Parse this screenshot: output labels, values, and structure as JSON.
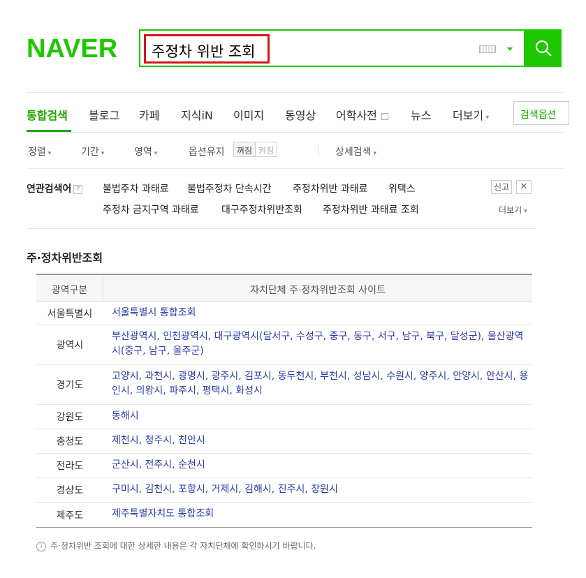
{
  "logo": "NAVER",
  "search": {
    "query": "주정차 위반 조회"
  },
  "tabs": [
    "통합검색",
    "블로그",
    "카페",
    "지식iN",
    "이미지",
    "동영상",
    "어학사전",
    "뉴스",
    "더보기"
  ],
  "search_options_label": "검색옵션",
  "filters": {
    "sort": "정렬",
    "period": "기간",
    "area": "영역",
    "keep": "옵션유지",
    "toggle_on": "꺼짐",
    "toggle_off": "켜짐",
    "detail": "상세검색"
  },
  "related": {
    "title": "연관검색어",
    "row1": [
      "불법주차 과태료",
      "불법주정차 단속시간",
      "주정차위반 과태료",
      "위택스"
    ],
    "row2": [
      "주정차 금지구역 과태료",
      "대구주정차위반조회",
      "주정차위반 과태료 조회"
    ],
    "report": "신고",
    "more": "더보기"
  },
  "section_title": "주·정차위반조회",
  "table": {
    "headers": [
      "광역구분",
      "자치단체 주·정차위반조회 사이트"
    ],
    "rows": [
      {
        "region": "서울특별시",
        "sites": "서울특별시 통합조회"
      },
      {
        "region": "광역시",
        "sites": "부산광역시, 인천광역시, 대구광역시(달서구, 수성구, 중구, 동구, 서구, 남구, 북구, 달성군), 울산광역시(중구, 남구, 울주군)"
      },
      {
        "region": "경기도",
        "sites": "고양시, 과천시, 광명시, 광주시, 김포시, 동두천시, 부천시, 성남시, 수원시, 양주시, 안양시, 안산시, 용인시, 의왕시, 파주시, 평택시, 화성시"
      },
      {
        "region": "강원도",
        "sites": "동해시"
      },
      {
        "region": "충청도",
        "sites": "제천시, 청주시, 천안시"
      },
      {
        "region": "전라도",
        "sites": "군산시, 전주시, 순천시"
      },
      {
        "region": "경상도",
        "sites": "구미시, 김천시, 포항시, 거제시, 김해시, 진주시, 창원시"
      },
      {
        "region": "제주도",
        "sites": "제주특별자치도 통합조회"
      }
    ]
  },
  "footnote": "주·정차위반 조회에 대한 상세한 내용은 각 자치단체에 확인하시기 바랍니다."
}
